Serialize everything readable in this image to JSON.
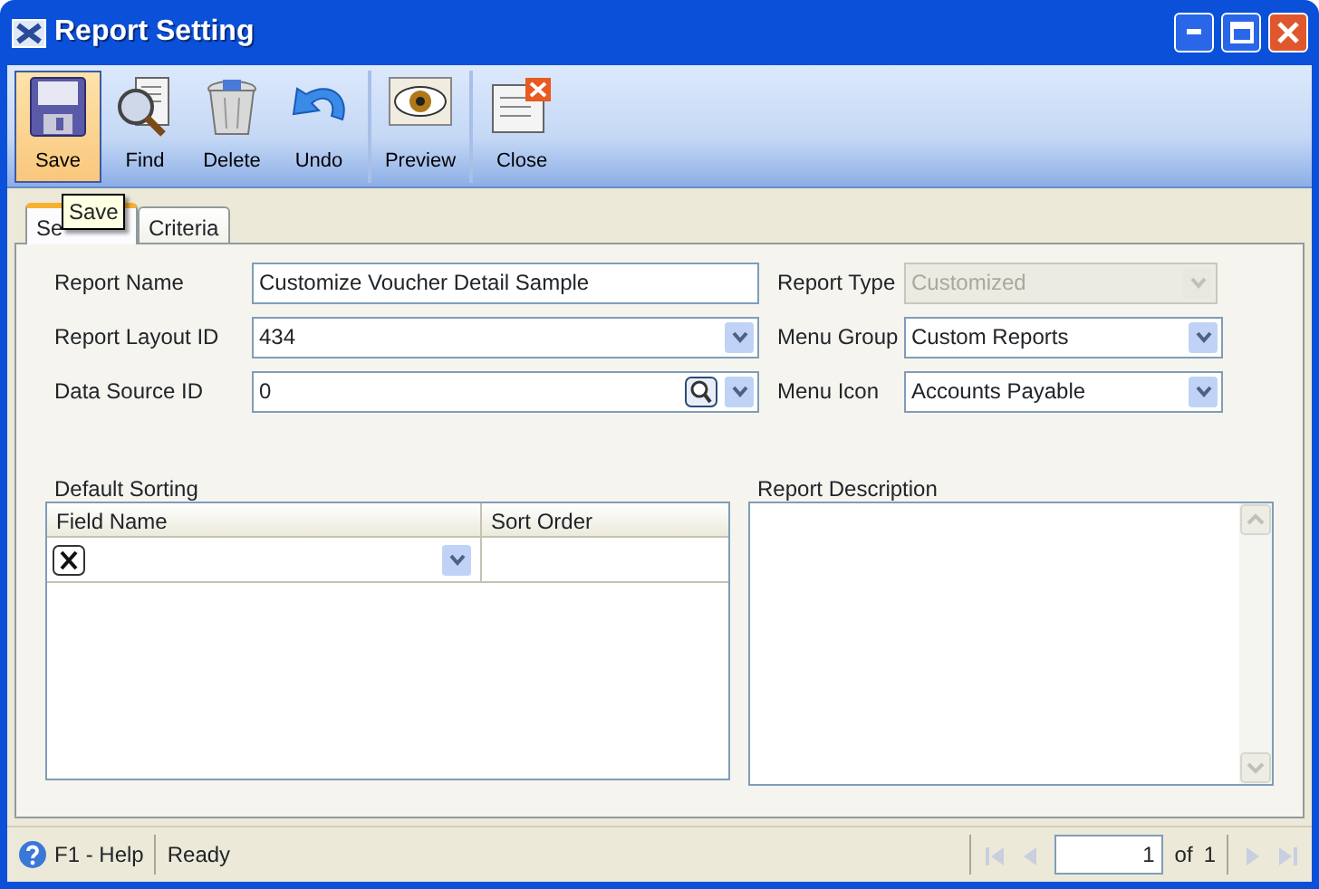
{
  "window": {
    "title": "Report Setting"
  },
  "toolbar": [
    {
      "buttons": [
        {
          "label": "Save",
          "selected": true
        },
        {
          "label": "Find",
          "selected": false
        },
        {
          "label": "Delete",
          "selected": false
        },
        {
          "label": "Undo",
          "selected": false
        }
      ]
    },
    {
      "buttons": [
        {
          "label": "Preview",
          "selected": false
        }
      ]
    },
    {
      "buttons": [
        {
          "label": "Close",
          "selected": false
        }
      ]
    }
  ],
  "tooltip": "Save",
  "tabs": [
    {
      "label": "Se",
      "selected": true
    },
    {
      "label": "Criteria",
      "selected": false
    }
  ],
  "left_fields": [
    {
      "label": "Report Name",
      "value": "Customize Voucher Detail Sample",
      "kind": "text"
    },
    {
      "label": "Report Layout ID",
      "value": "434",
      "kind": "combo"
    },
    {
      "label": "Data Source ID",
      "value": "0",
      "kind": "lookup"
    }
  ],
  "right_fields": [
    {
      "label": "Report Type",
      "value": "Customized",
      "kind": "combo",
      "disabled": true
    },
    {
      "label": "Menu Group",
      "value": "Custom Reports",
      "kind": "combo",
      "disabled": false
    },
    {
      "label": "Menu Icon",
      "value": "Accounts Payable",
      "kind": "combo",
      "disabled": false
    }
  ],
  "sorting": {
    "title": "Default Sorting",
    "columns": [
      "Field Name",
      "Sort Order"
    ]
  },
  "description": {
    "title": "Report Description"
  },
  "status_bar": {
    "help": "F1 - Help",
    "status": "Ready",
    "page": "1",
    "of": "of",
    "total": "1"
  }
}
